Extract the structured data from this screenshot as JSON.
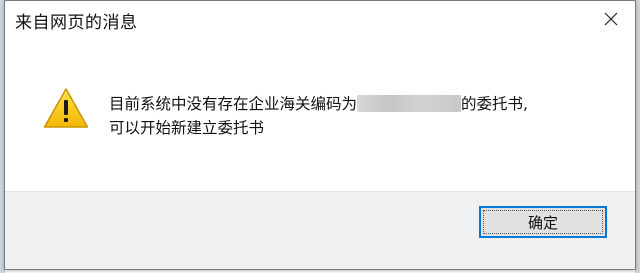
{
  "dialog": {
    "title": "来自网页的消息",
    "icon": "warning-triangle-icon",
    "message_part1": "目前系统中没有存在企业海关编码为",
    "message_part2": "的委托书,",
    "message_line2": "可以开始新建立委托书",
    "ok_label": "确定"
  },
  "colors": {
    "accent": "#0078d7",
    "warning": "#f5c518",
    "footer_bg": "#f0f0f0"
  }
}
